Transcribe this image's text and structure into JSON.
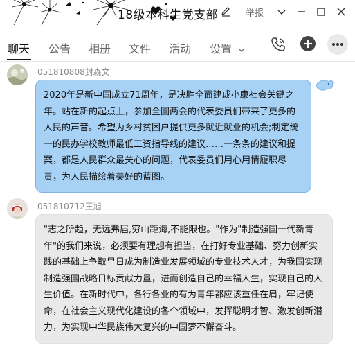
{
  "window": {
    "title": "18级本科生党支部",
    "report_label": "举报"
  },
  "tabs": [
    {
      "label": "聊天",
      "active": true
    },
    {
      "label": "公告"
    },
    {
      "label": "相册"
    },
    {
      "label": "文件"
    },
    {
      "label": "活动"
    },
    {
      "label": "设置"
    }
  ],
  "toolbar": {
    "icons": [
      "phone-icon",
      "add-icon",
      "more-icon"
    ]
  },
  "messages": [
    {
      "sender": "051810808封森文",
      "text": "2020年是新中国成立71周年，是决胜全面建成小康社会关键之年。站在新的起点上，参加全国两会的代表委员们带来了更多的人民的声音。希望为乡村贫困户提供更多就近就业的机会;制定统一的民办学校教师最低工资指导线的建议……一条条的建议和提案，都是人民群众最关心的问题，代表委员们用心用情履职尽责，为人民描绘着美好的蓝图。",
      "bubble_color": "#a7d1f5"
    },
    {
      "sender": "051810712王旭",
      "text": "\"志之所趋，无远弗届,穷山距海,不能限也。\"作为\"制造强国一代新青年\"的我们来说，必须要有理想有担当，在打好专业基础、努力创新实践的基础上争取早日成为制造业发展领域的专业技术人才，为我国实现制造强国战略目标贡献力量，进而创造自己的幸福人生，实现自己的人生价值。在新时代中，各行各业的有为青年都应该重任在肩，牢记使命，在社会主义现代化建设的各个领域中，发挥聪明才智、激发创新潜力，为实现中华民族伟大复兴的中国梦不懈奋斗。",
      "bubble_color": "#e9e9e9"
    }
  ]
}
